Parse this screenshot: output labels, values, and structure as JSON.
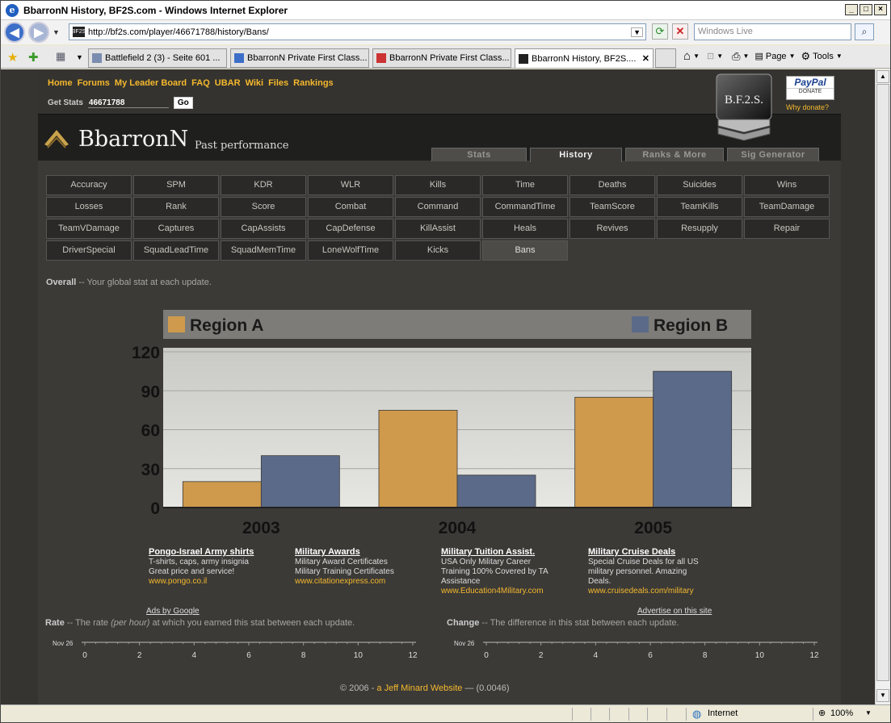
{
  "window": {
    "title": "BbarronN History, BF2S.com - Windows Internet Explorer"
  },
  "address": {
    "url": "http://bf2s.com/player/46671788/history/Bans/",
    "search_placeholder": "Windows Live",
    "favicon": "BF2S"
  },
  "tabs": [
    {
      "label": "Battlefield 2 (3) - Seite 601 ..."
    },
    {
      "label": "BbarronN Private First Class..."
    },
    {
      "label": "BbarronN Private First Class..."
    },
    {
      "label": "BbarronN History, BF2S...."
    }
  ],
  "toolbar": {
    "page_label": "Page",
    "tools_label": "Tools"
  },
  "status": {
    "zone": "Internet",
    "zoom": "100%"
  },
  "site": {
    "nav": [
      "Home",
      "Forums",
      "My Leader Board",
      "FAQ",
      "UBAR",
      "Wiki",
      "Files",
      "Rankings"
    ],
    "get_stats_label": "Get Stats",
    "get_stats_value": "46671788",
    "go_label": "Go",
    "logo_text": "B.F.2.S.",
    "paypal_label": "PayPal",
    "donate_label": "DONATE",
    "why_donate": "Why donate?",
    "username": "BbarronN",
    "subtitle": "Past performance",
    "section_tabs": [
      "Stats",
      "History",
      "Ranks & More",
      "Sig Generator"
    ],
    "active_section": "History"
  },
  "stat_buttons": [
    [
      "Accuracy",
      "SPM",
      "KDR",
      "WLR",
      "Kills",
      "Time",
      "Deaths",
      "Suicides",
      "Wins"
    ],
    [
      "Losses",
      "Rank",
      "Score",
      "Combat",
      "Command",
      "CommandTime",
      "TeamScore",
      "TeamKills",
      "TeamDamage"
    ],
    [
      "TeamVDamage",
      "Captures",
      "CapAssists",
      "CapDefense",
      "KillAssist",
      "Heals",
      "Revives",
      "Resupply",
      "Repair"
    ],
    [
      "DriverSpecial",
      "SquadLeadTime",
      "SquadMemTime",
      "LoneWolfTime",
      "Kicks",
      "Bans"
    ]
  ],
  "active_stat": "Bans",
  "overall": {
    "label": "Overall",
    "text": " -- Your global stat at each update."
  },
  "chart_data": {
    "type": "bar",
    "categories": [
      "2003",
      "2004",
      "2005"
    ],
    "series": [
      {
        "name": "Region A",
        "color": "#cf9a4c",
        "values": [
          20,
          75,
          85
        ]
      },
      {
        "name": "Region B",
        "color": "#5b6a88",
        "values": [
          40,
          25,
          105
        ]
      }
    ],
    "yticks": [
      0,
      30,
      60,
      90,
      120
    ],
    "ylim": [
      0,
      120
    ],
    "legend": "top",
    "grid": true
  },
  "ads": [
    {
      "title": "Pongo-Israel Army shirts",
      "lines": [
        "T-shirts, caps, army insignia",
        "Great price and service!"
      ],
      "url": "www.pongo.co.il"
    },
    {
      "title": "Military Awards",
      "lines": [
        "Military Award Certificates",
        "Military Training Certificates"
      ],
      "url": "www.citationexpress.com"
    },
    {
      "title": "Military Tuition Assist.",
      "lines": [
        "USA Only Military Career",
        "Training 100% Covered by TA",
        "Assistance"
      ],
      "url": "www.Education4Military.com"
    },
    {
      "title": "Military Cruise Deals",
      "lines": [
        "Special Cruise Deals for all US",
        "military personnel. Amazing",
        "Deals."
      ],
      "url": "www.cruisedeals.com/military"
    }
  ],
  "ads_by_google": "Ads by Google",
  "advertise": "Advertise on this site",
  "rate": {
    "label": "Rate",
    "pre": " -- The rate ",
    "em": "(per hour)",
    "post": " at which you earned this stat between each update."
  },
  "change": {
    "label": "Change",
    "text": " -- The difference in this stat between each update."
  },
  "mini_chart": {
    "date_label": "Nov 26",
    "ticks": [
      "0",
      "2",
      "4",
      "6",
      "8",
      "10",
      "12"
    ]
  },
  "footer": {
    "pre": "© 2006 - ",
    "link": "a Jeff Minard Website",
    "post": " — (0.0046)"
  }
}
